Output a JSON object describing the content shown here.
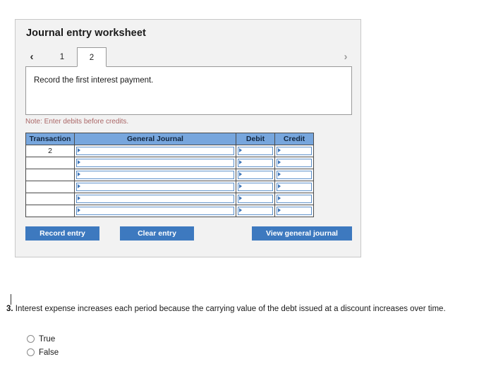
{
  "panel": {
    "title": "Journal entry worksheet",
    "tabs": {
      "prev_arrow": "‹",
      "next_arrow": "›",
      "items": [
        {
          "label": "1",
          "active": false
        },
        {
          "label": "2",
          "active": true
        }
      ]
    },
    "prompt": "Record the first interest payment.",
    "note": "Note: Enter debits before credits.",
    "table": {
      "headers": [
        "Transaction",
        "General Journal",
        "Debit",
        "Credit"
      ],
      "rows": [
        {
          "transaction": "2",
          "journal": "",
          "debit": "",
          "credit": ""
        },
        {
          "transaction": "",
          "journal": "",
          "debit": "",
          "credit": ""
        },
        {
          "transaction": "",
          "journal": "",
          "debit": "",
          "credit": ""
        },
        {
          "transaction": "",
          "journal": "",
          "debit": "",
          "credit": ""
        },
        {
          "transaction": "",
          "journal": "",
          "debit": "",
          "credit": ""
        },
        {
          "transaction": "",
          "journal": "",
          "debit": "",
          "credit": ""
        }
      ]
    },
    "buttons": {
      "record": "Record entry",
      "clear": "Clear entry",
      "view": "View general journal"
    }
  },
  "question": {
    "number": "3.",
    "text": "Interest expense increases each period because the carrying value of the debt issued at a discount increases over time.",
    "options": [
      {
        "label": "True",
        "selected": false
      },
      {
        "label": "False",
        "selected": false
      }
    ]
  },
  "colors": {
    "panel_background": "#f2f2f2",
    "table_header_blue": "#77a6dd",
    "button_blue": "#3d79bf",
    "note_red": "#aa6666",
    "input_border_blue": "#5b8fc9"
  }
}
